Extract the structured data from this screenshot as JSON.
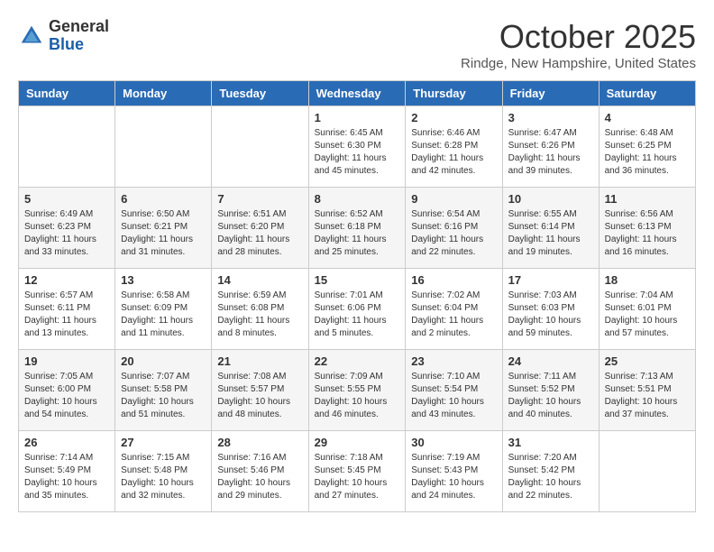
{
  "header": {
    "logo_general": "General",
    "logo_blue": "Blue",
    "month_title": "October 2025",
    "location": "Rindge, New Hampshire, United States"
  },
  "weekdays": [
    "Sunday",
    "Monday",
    "Tuesday",
    "Wednesday",
    "Thursday",
    "Friday",
    "Saturday"
  ],
  "weeks": [
    [
      {
        "day": "",
        "info": ""
      },
      {
        "day": "",
        "info": ""
      },
      {
        "day": "",
        "info": ""
      },
      {
        "day": "1",
        "info": "Sunrise: 6:45 AM\nSunset: 6:30 PM\nDaylight: 11 hours\nand 45 minutes."
      },
      {
        "day": "2",
        "info": "Sunrise: 6:46 AM\nSunset: 6:28 PM\nDaylight: 11 hours\nand 42 minutes."
      },
      {
        "day": "3",
        "info": "Sunrise: 6:47 AM\nSunset: 6:26 PM\nDaylight: 11 hours\nand 39 minutes."
      },
      {
        "day": "4",
        "info": "Sunrise: 6:48 AM\nSunset: 6:25 PM\nDaylight: 11 hours\nand 36 minutes."
      }
    ],
    [
      {
        "day": "5",
        "info": "Sunrise: 6:49 AM\nSunset: 6:23 PM\nDaylight: 11 hours\nand 33 minutes."
      },
      {
        "day": "6",
        "info": "Sunrise: 6:50 AM\nSunset: 6:21 PM\nDaylight: 11 hours\nand 31 minutes."
      },
      {
        "day": "7",
        "info": "Sunrise: 6:51 AM\nSunset: 6:20 PM\nDaylight: 11 hours\nand 28 minutes."
      },
      {
        "day": "8",
        "info": "Sunrise: 6:52 AM\nSunset: 6:18 PM\nDaylight: 11 hours\nand 25 minutes."
      },
      {
        "day": "9",
        "info": "Sunrise: 6:54 AM\nSunset: 6:16 PM\nDaylight: 11 hours\nand 22 minutes."
      },
      {
        "day": "10",
        "info": "Sunrise: 6:55 AM\nSunset: 6:14 PM\nDaylight: 11 hours\nand 19 minutes."
      },
      {
        "day": "11",
        "info": "Sunrise: 6:56 AM\nSunset: 6:13 PM\nDaylight: 11 hours\nand 16 minutes."
      }
    ],
    [
      {
        "day": "12",
        "info": "Sunrise: 6:57 AM\nSunset: 6:11 PM\nDaylight: 11 hours\nand 13 minutes."
      },
      {
        "day": "13",
        "info": "Sunrise: 6:58 AM\nSunset: 6:09 PM\nDaylight: 11 hours\nand 11 minutes."
      },
      {
        "day": "14",
        "info": "Sunrise: 6:59 AM\nSunset: 6:08 PM\nDaylight: 11 hours\nand 8 minutes."
      },
      {
        "day": "15",
        "info": "Sunrise: 7:01 AM\nSunset: 6:06 PM\nDaylight: 11 hours\nand 5 minutes."
      },
      {
        "day": "16",
        "info": "Sunrise: 7:02 AM\nSunset: 6:04 PM\nDaylight: 11 hours\nand 2 minutes."
      },
      {
        "day": "17",
        "info": "Sunrise: 7:03 AM\nSunset: 6:03 PM\nDaylight: 10 hours\nand 59 minutes."
      },
      {
        "day": "18",
        "info": "Sunrise: 7:04 AM\nSunset: 6:01 PM\nDaylight: 10 hours\nand 57 minutes."
      }
    ],
    [
      {
        "day": "19",
        "info": "Sunrise: 7:05 AM\nSunset: 6:00 PM\nDaylight: 10 hours\nand 54 minutes."
      },
      {
        "day": "20",
        "info": "Sunrise: 7:07 AM\nSunset: 5:58 PM\nDaylight: 10 hours\nand 51 minutes."
      },
      {
        "day": "21",
        "info": "Sunrise: 7:08 AM\nSunset: 5:57 PM\nDaylight: 10 hours\nand 48 minutes."
      },
      {
        "day": "22",
        "info": "Sunrise: 7:09 AM\nSunset: 5:55 PM\nDaylight: 10 hours\nand 46 minutes."
      },
      {
        "day": "23",
        "info": "Sunrise: 7:10 AM\nSunset: 5:54 PM\nDaylight: 10 hours\nand 43 minutes."
      },
      {
        "day": "24",
        "info": "Sunrise: 7:11 AM\nSunset: 5:52 PM\nDaylight: 10 hours\nand 40 minutes."
      },
      {
        "day": "25",
        "info": "Sunrise: 7:13 AM\nSunset: 5:51 PM\nDaylight: 10 hours\nand 37 minutes."
      }
    ],
    [
      {
        "day": "26",
        "info": "Sunrise: 7:14 AM\nSunset: 5:49 PM\nDaylight: 10 hours\nand 35 minutes."
      },
      {
        "day": "27",
        "info": "Sunrise: 7:15 AM\nSunset: 5:48 PM\nDaylight: 10 hours\nand 32 minutes."
      },
      {
        "day": "28",
        "info": "Sunrise: 7:16 AM\nSunset: 5:46 PM\nDaylight: 10 hours\nand 29 minutes."
      },
      {
        "day": "29",
        "info": "Sunrise: 7:18 AM\nSunset: 5:45 PM\nDaylight: 10 hours\nand 27 minutes."
      },
      {
        "day": "30",
        "info": "Sunrise: 7:19 AM\nSunset: 5:43 PM\nDaylight: 10 hours\nand 24 minutes."
      },
      {
        "day": "31",
        "info": "Sunrise: 7:20 AM\nSunset: 5:42 PM\nDaylight: 10 hours\nand 22 minutes."
      },
      {
        "day": "",
        "info": ""
      }
    ]
  ]
}
